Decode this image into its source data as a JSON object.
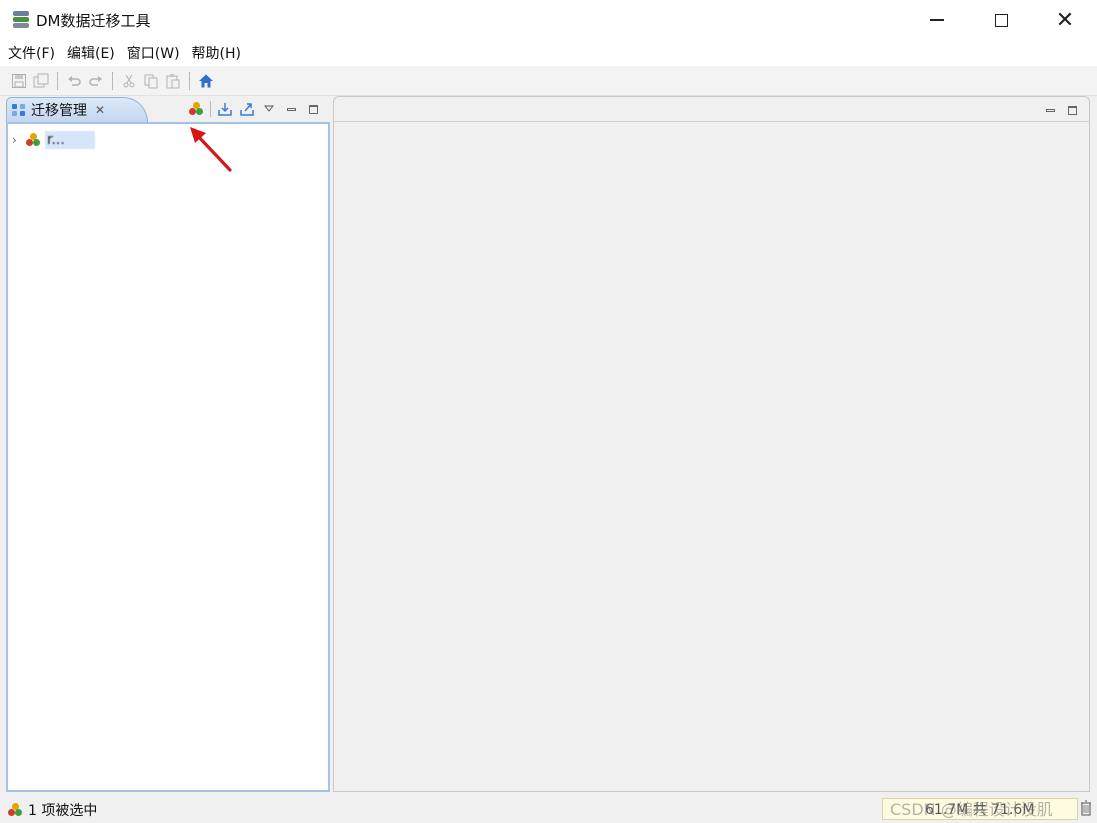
{
  "window": {
    "title": "DM数据迁移工具"
  },
  "menu": {
    "items": [
      "文件(F)",
      "编辑(E)",
      "窗口(W)",
      "帮助(H)"
    ]
  },
  "left_view": {
    "tab_label": "迁移管理",
    "tree": [
      {
        "label": "r..."
      }
    ]
  },
  "status": {
    "selection_text": "1 项被选中",
    "memory_text": "61.7M 共 71.6M",
    "watermark": "CSDN @编程设计没肌"
  },
  "colors": {
    "accent": "#3a7bd5",
    "tab_bg": "#c9dcf2",
    "annotation_arrow": "#d41818"
  }
}
